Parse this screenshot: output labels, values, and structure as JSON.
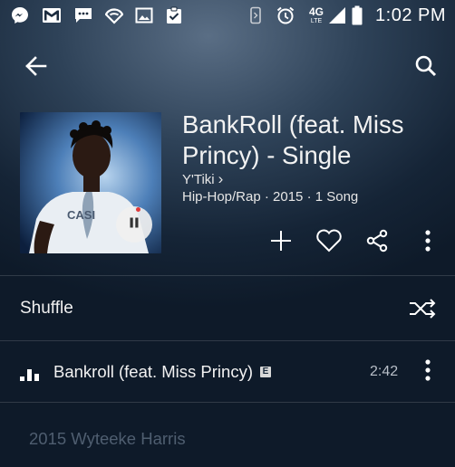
{
  "status_bar": {
    "time": "1:02 PM",
    "network_label": "4G",
    "network_sub": "LTE",
    "icons": [
      "messenger-icon",
      "gmail-icon",
      "sms-icon",
      "wifi-icon",
      "gallery-icon",
      "clipboard-check-icon",
      "vibrate-icon",
      "alarm-icon",
      "signal-icon",
      "battery-icon"
    ]
  },
  "topbar": {
    "back_icon": "arrow-left-icon",
    "search_icon": "search-icon"
  },
  "album": {
    "title": "BankRoll (feat. Miss Princy) - Single",
    "artist": "Y'Tiki",
    "artist_chevron": "›",
    "meta": "Hip-Hop/Rap · 2015 · 1 Song",
    "art_shirt_text": "CASI"
  },
  "actions": {
    "add_icon": "plus-icon",
    "like_icon": "heart-icon",
    "share_icon": "share-icon",
    "more_icon": "more-vertical-icon"
  },
  "shuffle": {
    "label": "Shuffle",
    "icon": "shuffle-icon"
  },
  "tracks": [
    {
      "title": "Bankroll (feat. Miss Princy)",
      "explicit_badge": "E",
      "duration": "2:42",
      "playing": true
    }
  ],
  "copyright": "2015 Wyteeke Harris",
  "colors": {
    "accent_red": "#e03a3a",
    "background_dark": "#152436",
    "divider": "rgba(255,255,255,0.14)"
  }
}
